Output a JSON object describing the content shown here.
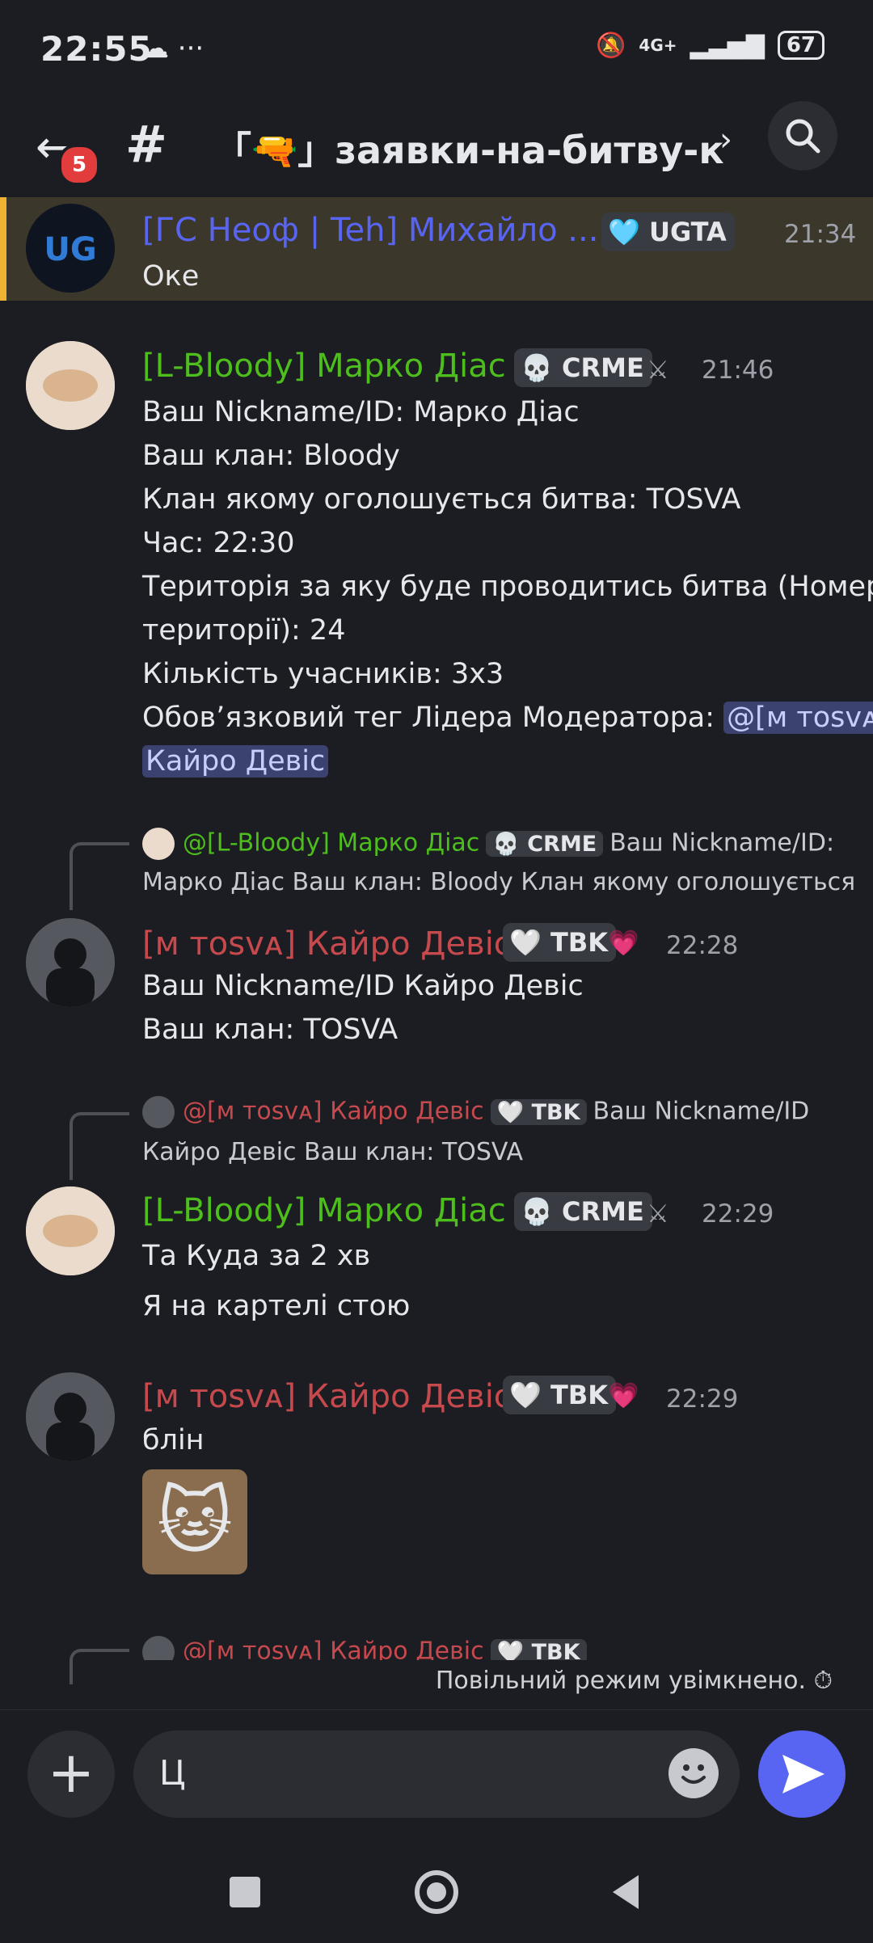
{
  "status": {
    "time": "22:55",
    "left_icons": "☁ ···",
    "network": "4G+",
    "battery": "67"
  },
  "header": {
    "back_badge": "5",
    "thread_icon": "#",
    "channel_name": "「🔫」заявки-на-битву-к..."
  },
  "messages": [
    {
      "author": "[ГС Неоф | Teh] Михайло ...",
      "author_color": "#5865f2",
      "tag": "🩵 UGTA",
      "time": "21:34",
      "lines": [
        "Оке"
      ]
    },
    {
      "author": "[L-Bloody] Марко Діас",
      "author_color": "#4dbe1c",
      "tag": "💀 CRME",
      "extra_icon": "⚔",
      "time": "21:46",
      "lines": [
        "Ваш Nickname/ID: Марко Діас",
        "Ваш клан: Bloody",
        "Клан якому оголошується битва: TOSVA",
        "Час: 22:30",
        "Територія за яку буде проводитись битва (Номер",
        "території): 24",
        "Кількість учасників: 3х3",
        "Обов’язковий тег Лідера Модератора: "
      ],
      "mention_part1": "@[м тosvᴀ]",
      "mention_part2": "Кайро Девіс"
    },
    {
      "reply": {
        "author": "@[L-Bloody] Марко Діас",
        "tag": "💀 CRME",
        "text1": "Ваш Nickname/ID:",
        "text2": "Марко Діас Ваш клан: Bloody Клан якому оголошується"
      },
      "author": "[м тosvᴀ] Кайро Девіс",
      "author_color": "#c6494d",
      "tag": "🤍 TBK",
      "extra_icon": "💗",
      "time": "22:28",
      "lines": [
        "Ваш Nickname/ID Кайро Девіс",
        "Ваш клан: TOSVA"
      ]
    },
    {
      "reply": {
        "author": "@[м тosvᴀ] Кайро Девіс",
        "tag": "🤍 TBK",
        "text1": "Ваш Nickname/ID",
        "text2": "Кайро Девіс Ваш клан: TOSVA"
      },
      "author": "[L-Bloody] Марко Діас",
      "author_color": "#4dbe1c",
      "tag": "💀 CRME",
      "extra_icon": "⚔",
      "time": "22:29",
      "lines": [
        "Та Куда за 2 хв",
        "Я на картелі стою"
      ]
    },
    {
      "author": "[м тosvᴀ] Кайро Девіс",
      "author_color": "#c6494d",
      "tag": "🤍 TBK",
      "extra_icon": "💗",
      "time": "22:29",
      "lines": [
        "блін"
      ],
      "sticker": "🐱"
    },
    {
      "reply": {
        "author": "@[м тosvᴀ] Кайро Девіс",
        "tag": "🤍 TBK"
      }
    }
  ],
  "slowmode": {
    "text": "Повільний режим увімкнено.",
    "icon": "⏱"
  },
  "composer": {
    "input_value": "Ц"
  }
}
